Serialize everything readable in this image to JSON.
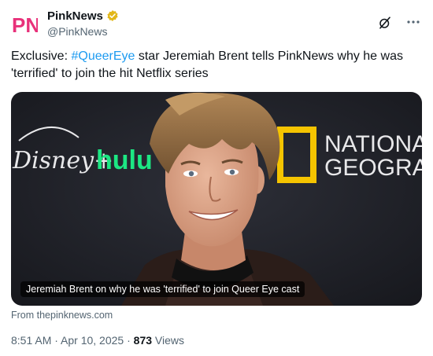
{
  "account": {
    "display_name": "PinkNews",
    "handle": "@PinkNews",
    "verified": true,
    "logo_text": "PN",
    "logo_color": "#e8317a"
  },
  "tweet": {
    "text_before": "Exclusive: ",
    "hashtag": "#QueerEye",
    "text_after": " star Jeremiah Brent tells PinkNews why he was 'terrified' to join the hit Netflix series",
    "hashtag_color": "#1d9bf0"
  },
  "media": {
    "caption": "Jeremiah Brent on why he was 'terrified' to join Queer Eye cast",
    "backdrop_logos": {
      "disney": "Disney+",
      "hulu": "hulu",
      "natgeo_line1": "NATIONA",
      "natgeo_line2": "GEOGRAI"
    }
  },
  "source": "From thepinknews.com",
  "meta": {
    "time": "8:51 AM · Apr 10, 2025 · ",
    "views": "873",
    "views_label": " Views"
  },
  "icons": [
    "verified-badge-icon",
    "grok-icon",
    "more-icon"
  ]
}
